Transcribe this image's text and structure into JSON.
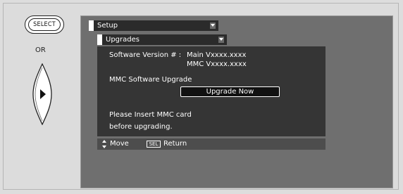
{
  "remote": {
    "select_label": "SELECT",
    "or_label": "OR",
    "dpad_icon": "dpad-right-icon"
  },
  "menu": {
    "setup_label": "Setup",
    "upgrades_label": "Upgrades"
  },
  "panel": {
    "sw_version_label": "Software Version # :",
    "main_version": "Main Vxxxx.xxxx",
    "mmc_version": "MMC Vxxxx.xxxx",
    "mmc_upgrade_label": "MMC Software Upgrade",
    "upgrade_button": "Upgrade Now",
    "insert_line1": "Please Insert MMC card",
    "insert_line2": "before upgrading."
  },
  "help": {
    "move_label": "Move",
    "sel_key": "SEL",
    "return_label": "Return"
  },
  "colors": {
    "screen_bg": "#6f6f6f",
    "panel_bg": "#353535",
    "bar_bg": "#2b2b2b",
    "help_bg": "#4d4d4d"
  }
}
